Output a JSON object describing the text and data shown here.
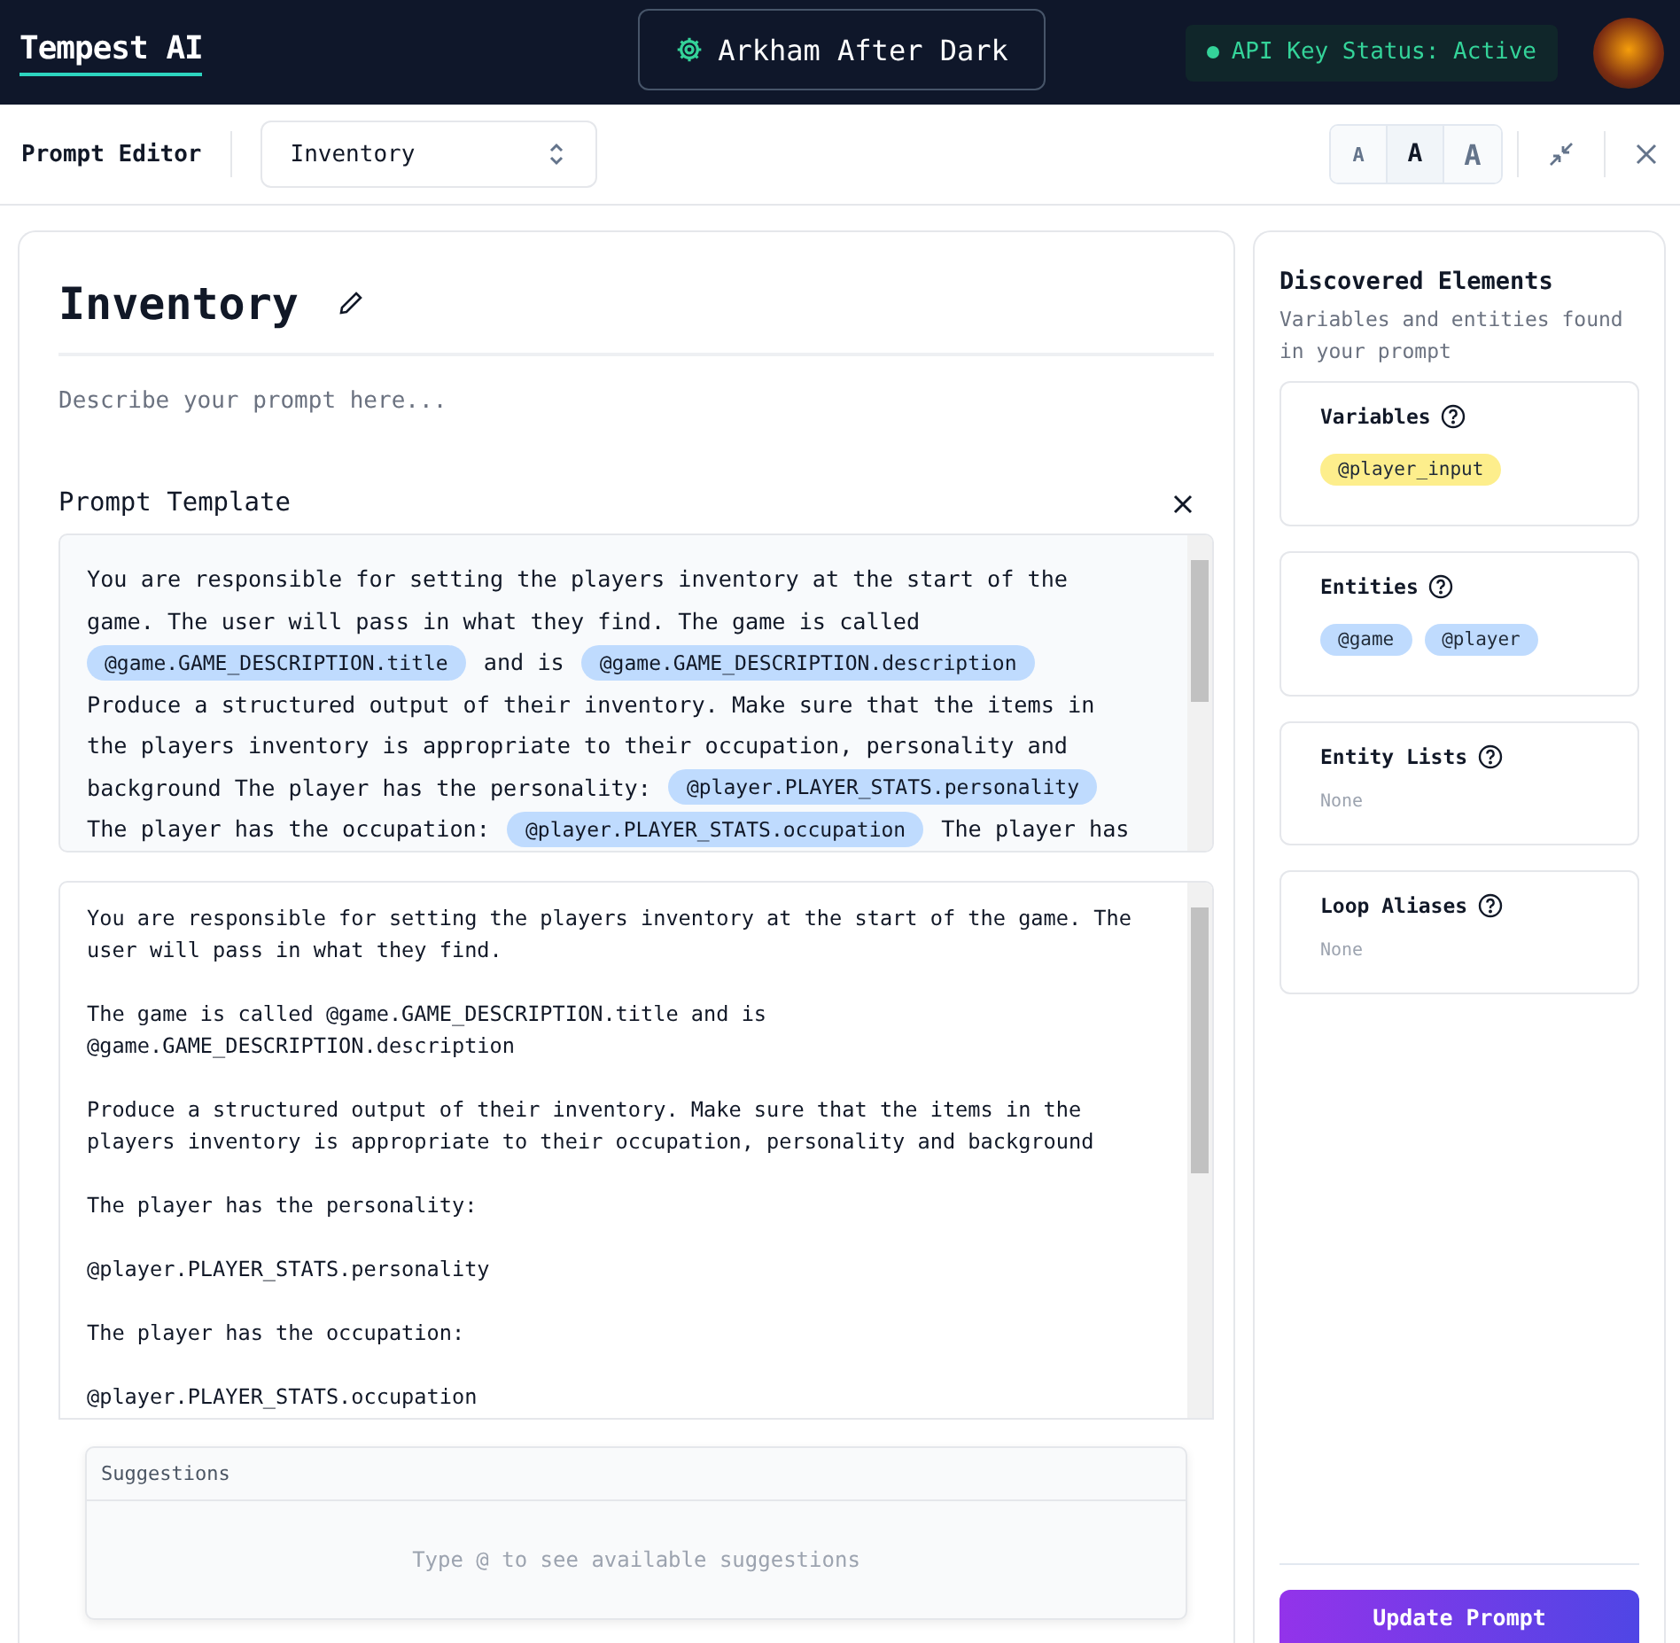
{
  "header": {
    "brand": "Tempest AI",
    "project": "Arkham After Dark",
    "api_status": {
      "label": "API Key Status: Active",
      "active": true
    }
  },
  "toolbar": {
    "title": "Prompt Editor",
    "prompt_select": {
      "value": "Inventory"
    },
    "font_sizes": [
      {
        "label": "A",
        "selected": false
      },
      {
        "label": "A",
        "selected": true
      },
      {
        "label": "A",
        "selected": false
      }
    ]
  },
  "editor": {
    "title": "Inventory",
    "description": {
      "placeholder": "Describe your prompt here..."
    },
    "template_label": "Prompt Template",
    "template_preview": [
      [
        {
          "kind": "text",
          "text": "You are responsible for setting the players inventory at the start of the"
        }
      ],
      [
        {
          "kind": "text",
          "text": "game. The user will pass in what they find. The game is called"
        }
      ],
      [
        {
          "kind": "token",
          "text": "@game.GAME_DESCRIPTION.title"
        },
        {
          "kind": "text",
          "text": "and is"
        },
        {
          "kind": "token",
          "text": "@game.GAME_DESCRIPTION.description"
        }
      ],
      [
        {
          "kind": "text",
          "text": "Produce a structured output of their inventory. Make sure that the items in"
        }
      ],
      [
        {
          "kind": "text",
          "text": "the players inventory is appropriate to their occupation, personality and"
        }
      ],
      [
        {
          "kind": "text",
          "text": "background The player has the personality:"
        },
        {
          "kind": "token",
          "text": "@player.PLAYER_STATS.personality"
        }
      ],
      [
        {
          "kind": "text",
          "text": "The player has the occupation:"
        },
        {
          "kind": "token",
          "text": "@player.PLAYER_STATS.occupation"
        },
        {
          "kind": "text",
          "text": "The player has"
        }
      ]
    ],
    "template_source": [
      "You are responsible for setting the players inventory at the start of the game. The user will pass in what they find.",
      "The game is called @game.GAME_DESCRIPTION.title and is @game.GAME_DESCRIPTION.description",
      "Produce a structured output of their inventory. Make sure that the items in the players inventory is appropriate to their occupation, personality and background",
      "The player has the personality:",
      "@player.PLAYER_STATS.personality",
      "The player has the occupation:",
      "@player.PLAYER_STATS.occupation"
    ],
    "suggestions": {
      "title": "Suggestions",
      "empty": "Type @ to see available suggestions"
    }
  },
  "sidebar": {
    "title": "Discovered Elements",
    "subtitle": "Variables and entities found in your prompt",
    "sections": [
      {
        "title": "Variables",
        "items": [
          {
            "label": "@player_input",
            "color": "#fdee8c"
          }
        ]
      },
      {
        "title": "Entities",
        "items": [
          {
            "label": "@game",
            "color": "#bfdbfe"
          },
          {
            "label": "@player",
            "color": "#bfdbfe"
          }
        ]
      },
      {
        "title": "Entity Lists",
        "empty": "None"
      },
      {
        "title": "Loop Aliases",
        "empty": "None"
      }
    ],
    "update_button": "Update Prompt"
  }
}
